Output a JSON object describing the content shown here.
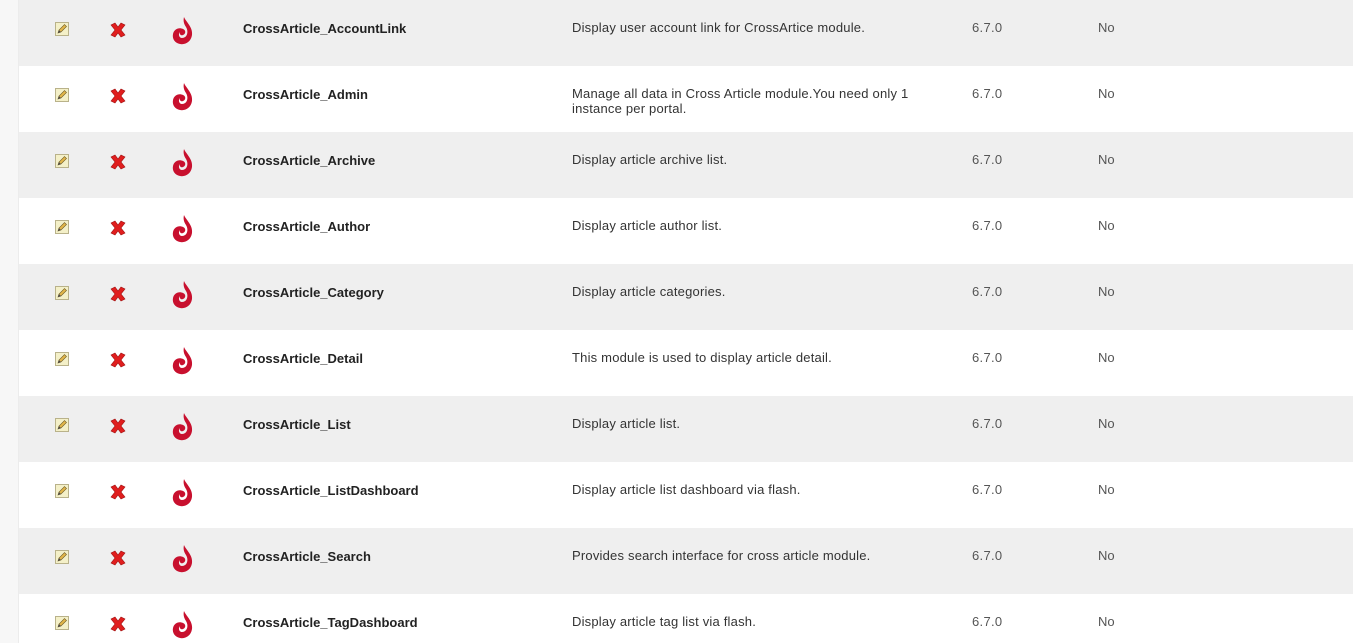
{
  "modules": [
    {
      "name": "CrossArticle_AccountLink",
      "description": "Display user account link for CrossArtice module.",
      "version": "6.7.0",
      "premium": "No"
    },
    {
      "name": "CrossArticle_Admin",
      "description": "Manage all data in Cross Article module.You need only 1 instance per portal.",
      "version": "6.7.0",
      "premium": "No"
    },
    {
      "name": "CrossArticle_Archive",
      "description": "Display article archive list.",
      "version": "6.7.0",
      "premium": "No"
    },
    {
      "name": "CrossArticle_Author",
      "description": "Display article author list.",
      "version": "6.7.0",
      "premium": "No"
    },
    {
      "name": "CrossArticle_Category",
      "description": "Display article categories.",
      "version": "6.7.0",
      "premium": "No"
    },
    {
      "name": "CrossArticle_Detail",
      "description": "This module is used to display article detail.",
      "version": "6.7.0",
      "premium": "No"
    },
    {
      "name": "CrossArticle_List",
      "description": "Display article list.",
      "version": "6.7.0",
      "premium": "No"
    },
    {
      "name": "CrossArticle_ListDashboard",
      "description": "Display article list dashboard via flash.",
      "version": "6.7.0",
      "premium": "No"
    },
    {
      "name": "CrossArticle_Search",
      "description": "Provides search interface for cross article module.",
      "version": "6.7.0",
      "premium": "No"
    },
    {
      "name": "CrossArticle_TagDashboard",
      "description": "Display article tag list via flash.",
      "version": "6.7.0",
      "premium": "No"
    }
  ],
  "icons": {
    "edit": "pencil-edit-icon",
    "delete": "red-x-delete-icon",
    "logo": "dotnetnuke-logo-icon"
  },
  "colors": {
    "row_alt": "#efefef",
    "delete_red": "#e01e1e",
    "logo_red": "#c8102e"
  }
}
